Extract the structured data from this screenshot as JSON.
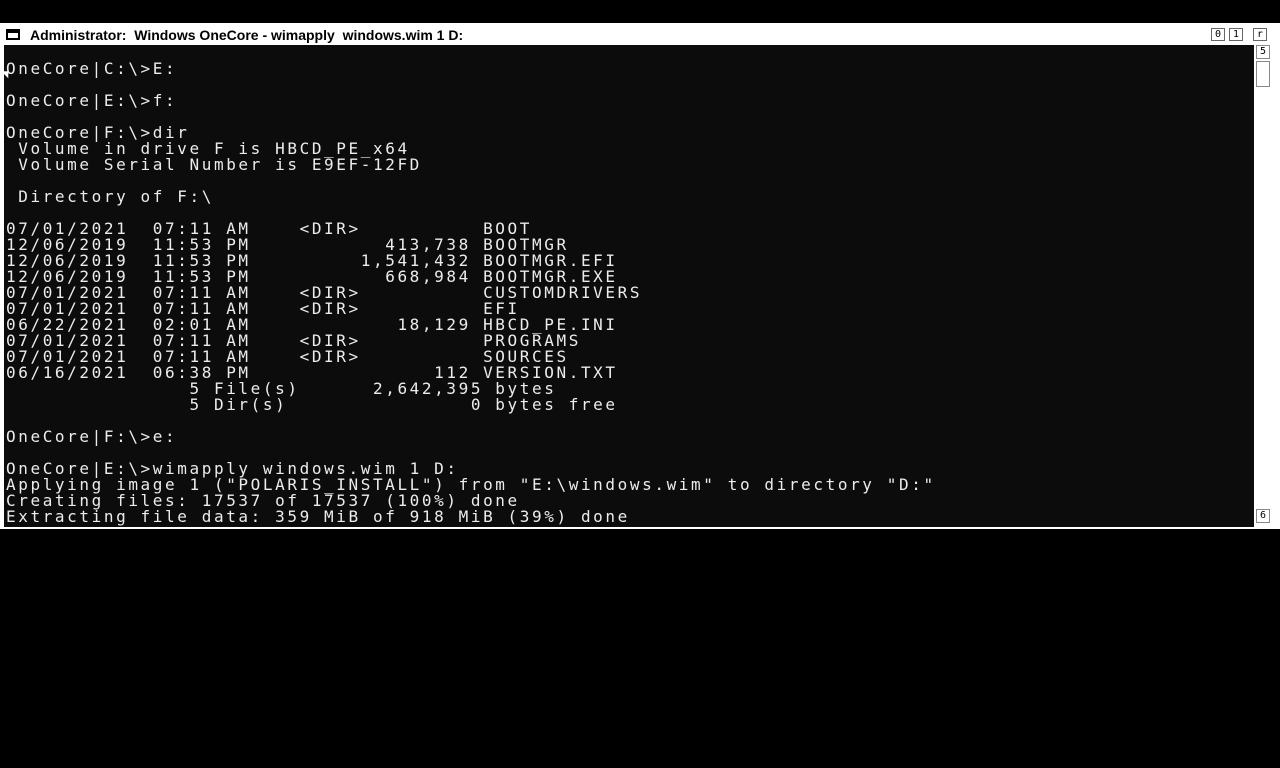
{
  "window": {
    "title": "Administrator:  Windows OneCore - wimapply  windows.wim 1 D:",
    "buttons": {
      "minimize": "0",
      "maximize": "1",
      "close": "r"
    }
  },
  "scrollbar": {
    "up_arrow": "5",
    "down_arrow": "6"
  },
  "console": {
    "background": "#0c0c0c",
    "foreground": "#ececec",
    "lines": [
      "",
      "OneCore|C:\\>E:",
      "",
      "OneCore|E:\\>f:",
      "",
      "OneCore|F:\\>dir",
      " Volume in drive F is HBCD_PE_x64",
      " Volume Serial Number is E9EF-12FD",
      "",
      " Directory of F:\\",
      "",
      "07/01/2021  07:11 AM    <DIR>          BOOT",
      "12/06/2019  11:53 PM           413,738 BOOTMGR",
      "12/06/2019  11:53 PM         1,541,432 BOOTMGR.EFI",
      "12/06/2019  11:53 PM           668,984 BOOTMGR.EXE",
      "07/01/2021  07:11 AM    <DIR>          CUSTOMDRIVERS",
      "07/01/2021  07:11 AM    <DIR>          EFI",
      "06/22/2021  02:01 AM            18,129 HBCD_PE.INI",
      "07/01/2021  07:11 AM    <DIR>          PROGRAMS",
      "07/01/2021  07:11 AM    <DIR>          SOURCES",
      "06/16/2021  06:38 PM               112 VERSION.TXT",
      "               5 File(s)      2,642,395 bytes",
      "               5 Dir(s)               0 bytes free",
      "",
      "OneCore|F:\\>e:",
      "",
      "OneCore|E:\\>wimapply windows.wim 1 D:",
      "Applying image 1 (\"POLARIS_INSTALL\") from \"E:\\windows.wim\" to directory \"D:\"",
      "Creating files: 17537 of 17537 (100%) done",
      "Extracting file data: 359 MiB of 918 MiB (39%) done"
    ]
  }
}
